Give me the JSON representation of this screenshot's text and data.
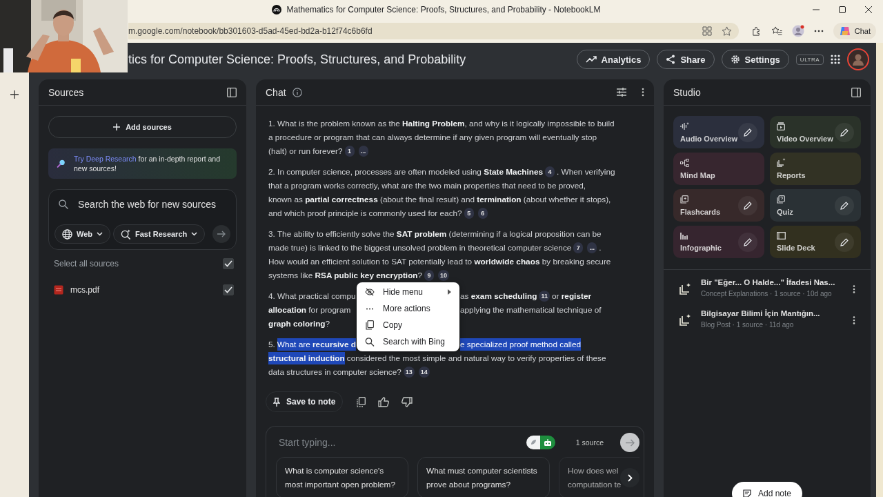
{
  "browser": {
    "title": "Mathematics for Computer Science: Proofs, Structures, and Probability - NotebookLM",
    "url": "m.google.com/notebook/bb301603-d5ad-45ed-bd2a-b12f74c6b6fd",
    "chat_button": "Chat"
  },
  "notebook": {
    "title": "tics for Computer Science: Proofs, Structures, and Probability",
    "buttons": [
      {
        "kind": "analytics",
        "label": "Analytics"
      },
      {
        "kind": "share",
        "label": "Share"
      },
      {
        "kind": "settings",
        "label": "Settings"
      }
    ],
    "badge": "ULTRA"
  },
  "sources": {
    "title": "Sources",
    "add_button": "Add sources",
    "banner": {
      "link": "Try Deep Research",
      "text": "for an in-depth report and new sources!"
    },
    "search": {
      "placeholder": "Search the web for new sources",
      "chips": [
        {
          "kind": "web",
          "label": "Web"
        },
        {
          "kind": "research",
          "label": "Fast Research"
        }
      ]
    },
    "select_all": {
      "label": "Select all sources",
      "checked": true
    },
    "items": [
      {
        "name": "mcs.pdf",
        "checked": true
      }
    ]
  },
  "chat": {
    "title": "Chat",
    "questions": [
      {
        "lines": [
          {
            "segs": [
              {
                "kind": "text",
                "text": "1. What is the problem known as the **Halting Problem**, and why is it logically impossible to build"
              }
            ]
          },
          {
            "segs": [
              {
                "kind": "text",
                "text": "a procedure or program that can always determine if any given program will eventually stop"
              }
            ]
          },
          {
            "segs": [
              {
                "kind": "text",
                "text": "(halt) or run forever?"
              },
              {
                "kind": "cite",
                "text": "1"
              },
              {
                "kind": "cite",
                "text": "..."
              }
            ]
          }
        ]
      },
      {
        "lines": [
          {
            "segs": [
              {
                "kind": "text",
                "text": "2. In computer science, processes are often modeled using **State Machines**"
              },
              {
                "kind": "cite",
                "text": "4"
              },
              {
                "kind": "text",
                "text": ". When verifying"
              }
            ]
          },
          {
            "segs": [
              {
                "kind": "text",
                "text": "that a program works correctly, what are the two main properties that need to be proved,"
              }
            ]
          },
          {
            "segs": [
              {
                "kind": "text",
                "text": "known as **partial correctness** (about the final result) and **termination** (about whether it stops),"
              }
            ]
          },
          {
            "segs": [
              {
                "kind": "text",
                "text": "and which proof principle is commonly used for each?"
              },
              {
                "kind": "cite",
                "text": "5"
              },
              {
                "kind": "cite",
                "text": "6"
              }
            ]
          }
        ]
      },
      {
        "lines": [
          {
            "segs": [
              {
                "kind": "text",
                "text": "3. The ability to efficiently solve the **SAT problem** (determining if a logical proposition can be"
              }
            ]
          },
          {
            "segs": [
              {
                "kind": "text",
                "text": "made true) is linked to the biggest unsolved problem in theoretical computer science"
              },
              {
                "kind": "cite",
                "text": "7"
              },
              {
                "kind": "cite",
                "text": "..."
              },
              {
                "kind": "text",
                "text": "."
              }
            ]
          },
          {
            "segs": [
              {
                "kind": "text",
                "text": "How would an efficient solution to SAT potentially lead to **worldwide chaos** by breaking secure"
              }
            ]
          },
          {
            "segs": [
              {
                "kind": "text",
                "text": "systems like **RSA public key encryption**?"
              },
              {
                "kind": "cite",
                "text": "9"
              },
              {
                "kind": "cite",
                "text": "10"
              }
            ]
          }
        ]
      },
      {
        "lines": [
          {
            "segs": [
              {
                "kind": "text",
                "text": "4. What practical compu"
              }
            ],
            "right": [
              {
                "kind": "text",
                "text": "as **exam scheduling**"
              },
              {
                "kind": "cite",
                "text": "11"
              },
              {
                "kind": "text",
                "text": "or **register**"
              }
            ]
          },
          {
            "segs": [
              {
                "kind": "text",
                "text": "**allocation** for program"
              }
            ],
            "right": [
              {
                "kind": "text",
                "text": "applying the mathematical technique of"
              }
            ]
          },
          {
            "segs": [
              {
                "kind": "text",
                "text": "**graph coloring**?"
              }
            ]
          }
        ]
      },
      {
        "lines": [
          {
            "segs": [
              {
                "kind": "text",
                "text": "5."
              },
              {
                "kind": "highlight",
                "text": "What are **recursive d**"
              }
            ],
            "right": [
              {
                "kind": "highlight",
                "text": "e specialized proof method called"
              }
            ]
          },
          {
            "segs": [
              {
                "kind": "highlight",
                "text": "**structural induction**"
              },
              {
                "kind": "text",
                "text": "considered the most simple and natural way to verify properties of these"
              }
            ]
          },
          {
            "segs": [
              {
                "kind": "text",
                "text": "data structures in computer science?"
              },
              {
                "kind": "cite",
                "text": "13"
              },
              {
                "kind": "cite",
                "text": "14"
              }
            ]
          }
        ]
      }
    ],
    "context_menu": [
      {
        "kind": "hide",
        "label": "Hide menu"
      },
      {
        "kind": "more",
        "label": "More actions"
      },
      {
        "kind": "copy",
        "label": "Copy"
      },
      {
        "kind": "search",
        "label": "Search with Bing"
      }
    ],
    "save_button": "Save to note",
    "input": {
      "placeholder": "Start typing...",
      "source_count": "1 source"
    },
    "suggestions": [
      {
        "lines": [
          "What is computer science's",
          "most important open problem?"
        ],
        "faded": false
      },
      {
        "lines": [
          "What must computer scientists",
          "prove about programs?"
        ],
        "faded": false
      },
      {
        "lines": [
          "How does wel",
          "computation te"
        ],
        "faded": true
      }
    ]
  },
  "studio": {
    "title": "Studio",
    "tiles": [
      {
        "kind": "audio",
        "label": "Audio Overview",
        "color": "#2b2f3d",
        "editable": true
      },
      {
        "kind": "video",
        "label": "Video Overview",
        "color": "#2a3229",
        "editable": true
      },
      {
        "kind": "mindmap",
        "label": "Mind Map",
        "color": "#37262f",
        "editable": false
      },
      {
        "kind": "reports",
        "label": "Reports",
        "color": "#323224",
        "editable": false
      },
      {
        "kind": "flashcards",
        "label": "Flashcards",
        "color": "#37292a",
        "editable": true
      },
      {
        "kind": "quiz",
        "label": "Quiz",
        "color": "#2a3135",
        "editable": true
      },
      {
        "kind": "infographic",
        "label": "Infographic",
        "color": "#36252f",
        "editable": true
      },
      {
        "kind": "slides",
        "label": "Slide Deck",
        "color": "#32301f",
        "editable": true
      }
    ],
    "notes": [
      {
        "title": "Bir \"Eğer... O Halde...\" İfadesi Nas...",
        "meta": "Concept Explanations · 1 source · 10d ago"
      },
      {
        "title": "Bilgisayar Bilimi İçin Mantığın...",
        "meta": "Blog Post · 1 source · 11d ago"
      }
    ],
    "add_note": "Add note"
  }
}
